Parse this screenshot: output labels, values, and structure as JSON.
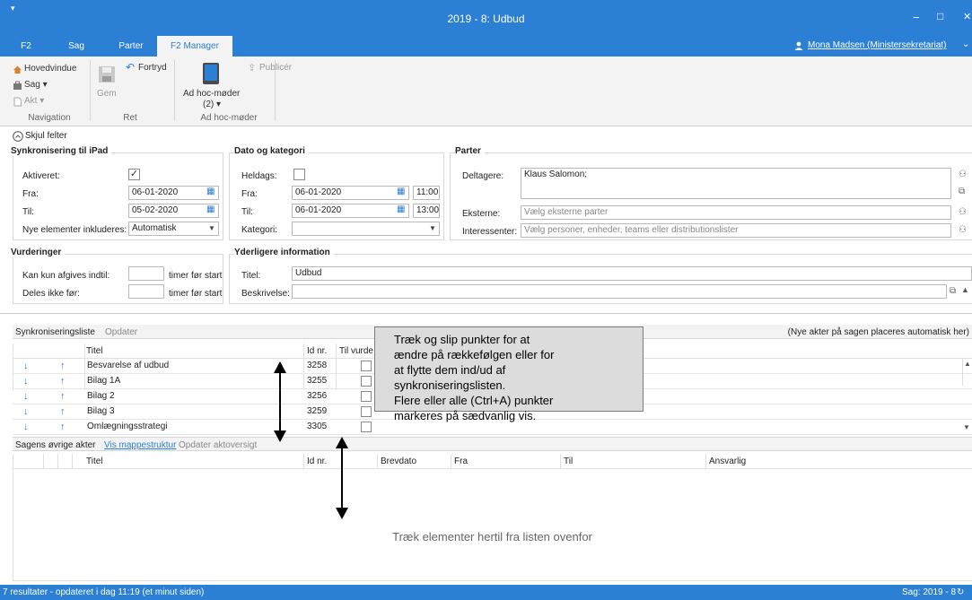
{
  "window": {
    "title": "2019 - 8: Udbud",
    "menu_glyph": "▾",
    "min_glyph": "−",
    "max_glyph": "□",
    "close_glyph": "✕"
  },
  "ribbon_tabs": [
    "F2",
    "Sag",
    "Parter",
    "F2 Manager"
  ],
  "user": {
    "name": "Mona Madsen (Ministersekretariat)",
    "overflow": "⌄"
  },
  "ribbon": {
    "hovedvindue": "Hovedvindue",
    "sag": "Sag ▾",
    "akt": "Akt ▾",
    "gem": "Gem",
    "fortryd": "Fortryd",
    "adhoc": "Ad hoc-møder",
    "adhoc_count": "(2) ▾",
    "publicer": "Publicér",
    "groups": {
      "navigation": "Navigation",
      "ret": "Ret",
      "adhoc": "Ad hoc-møder"
    }
  },
  "toggle": {
    "label": "Skjul felter"
  },
  "sync": {
    "heading": "Synkronisering til iPad",
    "aktiveret_label": "Aktiveret:",
    "aktiveret_checked": true,
    "fra_label": "Fra:",
    "fra": "06-01-2020",
    "til_label": "Til:",
    "til": "05-02-2020",
    "nye_label": "Nye elementer inkluderes:",
    "nye": "Automatisk"
  },
  "dato": {
    "heading": "Dato og kategori",
    "heldags_label": "Heldags:",
    "fra_label": "Fra:",
    "fra_date": "06-01-2020",
    "fra_time": "11:00",
    "til_label": "Til:",
    "til_date": "06-01-2020",
    "til_time": "13:00",
    "kategori_label": "Kategori:",
    "kategori": ""
  },
  "parter": {
    "heading": "Parter",
    "deltagere_label": "Deltagere:",
    "deltagere": "Klaus Salomon;",
    "eksterne_label": "Eksterne:",
    "eksterne_placeholder": "Vælg eksterne parter",
    "interessenter_label": "Interessenter:",
    "interessenter_placeholder": "Vælg personer, enheder, teams eller distributionslister"
  },
  "vurderinger": {
    "heading": "Vurderinger",
    "afgives_label": "Kan kun afgives indtil:",
    "afgives_unit": "timer før start",
    "deles_label": "Deles ikke før:",
    "deles_unit": "timer før start"
  },
  "info": {
    "heading": "Yderligere information",
    "titel_label": "Titel:",
    "titel": "Udbud",
    "beskrivelse_label": "Beskrivelse:"
  },
  "sync_list": {
    "tab": "Synkroniseringsliste",
    "update": "Opdater",
    "note": "(Nye akter på sagen placeres automatisk her)",
    "columns": {
      "titel": "Titel",
      "id": "Id nr.",
      "til": "Til vurde"
    },
    "rows": [
      {
        "title": "Besvarelse af udbud",
        "id": "3258"
      },
      {
        "title": "Bilag 1A",
        "id": "3255"
      },
      {
        "title": "Bilag 2",
        "id": "3256"
      },
      {
        "title": "Bilag 3",
        "id": "3259"
      },
      {
        "title": "Omlægningsstrategi",
        "id": "3305"
      }
    ]
  },
  "other_list": {
    "tab": "Sagens øvrige akter",
    "link1": "Vis mappestruktur",
    "link2": "Opdater aktoversigt",
    "columns": {
      "titel": "Titel",
      "id": "Id nr.",
      "brevdato": "Brevdato",
      "fra": "Fra",
      "til": "Til",
      "ansvarlig": "Ansvarlig"
    },
    "empty": "Træk elementer hertil fra listen ovenfor"
  },
  "callout": {
    "lines": [
      "Træk og slip punkter for at",
      "ændre på rækkefølgen eller for",
      "at flytte dem ind/ud af",
      "synkroniseringslisten.",
      "Flere eller alle (Ctrl+A) punkter",
      "markeres på sædvanlig vis."
    ]
  },
  "status": {
    "left": "7 resultater - opdateret i dag 11:19 (et minut siden)",
    "right": "Sag: 2019 - 8"
  },
  "colors": {
    "accent": "#2b7fd4",
    "ribbon_bg": "#f3f3f3",
    "callout_bg": "#dcdcdc"
  }
}
